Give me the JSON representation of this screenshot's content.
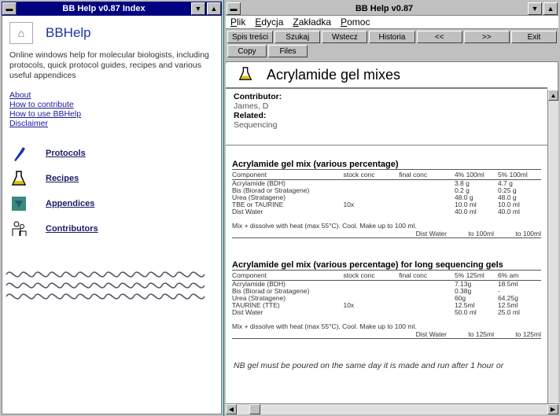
{
  "left_window": {
    "title": "BB Help v0.87 Index",
    "header_title": "BBHelp",
    "intro": "Online windows help for molecular biologists, including protocols, quick protocol guides, recipes and various useful appendices",
    "links": [
      "About",
      "How to contribute",
      "How to use BBHelp",
      "Disclaimer"
    ],
    "sections": [
      {
        "label": "Protocols",
        "icon": "pipette-icon"
      },
      {
        "label": "Recipes",
        "icon": "flask-icon"
      },
      {
        "label": "Appendices",
        "icon": "triangle-icon"
      },
      {
        "label": "Contributors",
        "icon": "people-icon"
      }
    ]
  },
  "right_window": {
    "title": "BB Help v0.87",
    "menu": [
      "Plik",
      "Edycja",
      "Zakładka",
      "Pomoc"
    ],
    "toolbar": {
      "row1": [
        "Spis treści",
        "Szukaj",
        "Wstecz",
        "Historia",
        "<<",
        ">>",
        "Exit"
      ],
      "row2": [
        "Copy",
        "Files"
      ]
    },
    "topic_title": "Acrylamide gel mixes",
    "contributor_label": "Contributor:",
    "contributor_value": "James, D",
    "related_label": "Related:",
    "related_value": "Sequencing",
    "table1": {
      "title": "Acrylamide gel mix (various percentage)",
      "headers": [
        "Component",
        "stock conc",
        "final conc",
        "4% 100ml",
        "5% 100ml"
      ],
      "rows": [
        [
          "Acrylamide (BDH)",
          "",
          "",
          "3.8 g",
          "4.7 g"
        ],
        [
          "Bis (Biorad or Stratagene)",
          "",
          "",
          "0.2 g",
          "0.25 g"
        ],
        [
          "Urea (Stratagene)",
          "",
          "",
          "48.0 g",
          "48.0 g"
        ],
        [
          "TBE or TAURINE",
          "10x",
          "",
          "10.0 ml",
          "10.0 ml"
        ],
        [
          "Dist Water",
          "",
          "",
          "40.0 ml",
          "40.0 ml"
        ]
      ],
      "note": "Mix + dissolve with heat (max 55°C). Cool. Make up to 100 ml.",
      "final_label": "Dist Water",
      "final_values": [
        "to 100ml",
        "to 100ml"
      ]
    },
    "table2": {
      "title": "Acrylamide gel mix (various percentage) for long sequencing gels",
      "headers": [
        "Component",
        "stock conc",
        "final conc",
        "5% 125ml",
        "6% am"
      ],
      "rows": [
        [
          "Acrylamide (BDH)",
          "",
          "",
          "7.13g",
          "18.5ml"
        ],
        [
          "Bis (Biorad or Stratagene)",
          "",
          "",
          "0.38g",
          "-"
        ],
        [
          "Urea (Stratagene)",
          "",
          "",
          "60g",
          "64.25g"
        ],
        [
          "TAURINE (TTE)",
          "10x",
          "",
          "12.5ml",
          "12.5ml"
        ],
        [
          "Dist Water",
          "",
          "",
          "50.0 ml",
          "25.0 ml"
        ]
      ],
      "note": "Mix + dissolve with heat (max 55°C). Cool. Make up to 100 ml.",
      "final_label": "Dist Water",
      "final_values": [
        "to 125ml",
        "to 125ml"
      ]
    },
    "footer_note": "NB gel must be poured on the same day it is made and run after 1 hour or"
  }
}
